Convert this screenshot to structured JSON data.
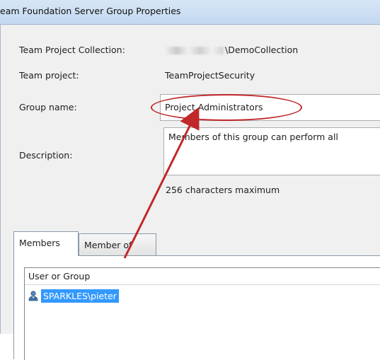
{
  "window": {
    "title": "eam Foundation Server Group Properties"
  },
  "fields": {
    "collection_label": "Team Project Collection:",
    "collection_value": "\\DemoCollection",
    "project_label": "Team project:",
    "project_value": "TeamProjectSecurity",
    "group_name_label": "Group name:",
    "group_name_value": "Project Administrators",
    "description_label": "Description:",
    "description_value": "Members of this group can perform all",
    "char_limit_note": "256 characters maximum"
  },
  "tabs": [
    {
      "label": "Members",
      "active": true
    },
    {
      "label": "Member of",
      "active": false
    }
  ],
  "members_list": {
    "column_header": "User or Group",
    "rows": [
      {
        "name": "SPARKLES\\pieter",
        "icon": "user-icon",
        "selected": true
      }
    ]
  },
  "annotation": {
    "oval_color": "#c0282a",
    "arrow_color": "#c0282a"
  },
  "colors": {
    "selection": "#3399ff",
    "dialog_bg": "#f0f0f0",
    "titlebar_bg": "#c9dcf2"
  }
}
